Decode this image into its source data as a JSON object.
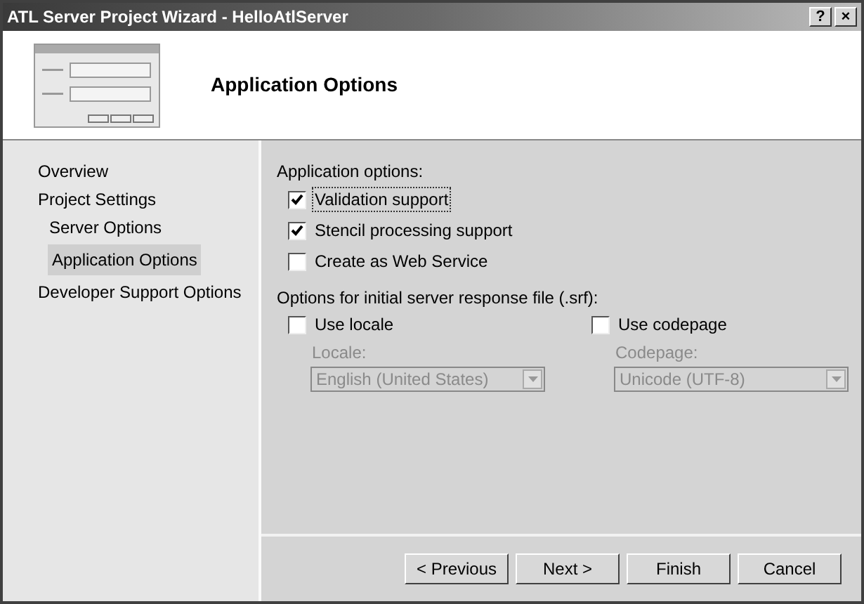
{
  "window": {
    "title": "ATL Server Project Wizard - HelloAtlServer",
    "title_buttons": [
      "?",
      "×"
    ]
  },
  "header": {
    "title": "Application Options"
  },
  "sidebar": {
    "items": [
      {
        "label": "Overview",
        "selected": false
      },
      {
        "label": "Project Settings",
        "selected": false,
        "children": [
          {
            "label": "Server Options",
            "selected": false
          },
          {
            "label": "Application Options",
            "selected": true
          }
        ]
      },
      {
        "label": "Developer Support Options",
        "selected": false
      }
    ]
  },
  "application_options": {
    "label": "Application options:",
    "checkboxes": [
      {
        "label": "Validation support",
        "checked": true,
        "focused": true
      },
      {
        "label": "Stencil processing support",
        "checked": true,
        "focused": false
      },
      {
        "label": "Create as Web Service",
        "checked": false,
        "focused": false
      }
    ]
  },
  "srf_options": {
    "label": "Options for initial server response file (.srf):",
    "columns": [
      {
        "checkbox": {
          "label": "Use locale",
          "checked": false
        },
        "field_label": "Locale:",
        "dropdown": {
          "value": "English (United States)",
          "disabled": true
        }
      },
      {
        "checkbox": {
          "label": "Use codepage",
          "checked": false
        },
        "field_label": "Codepage:",
        "dropdown": {
          "value": "Unicode (UTF-8)",
          "disabled": true
        }
      }
    ]
  },
  "buttons": [
    "< Previous",
    "Next >",
    "Finish",
    "Cancel"
  ]
}
